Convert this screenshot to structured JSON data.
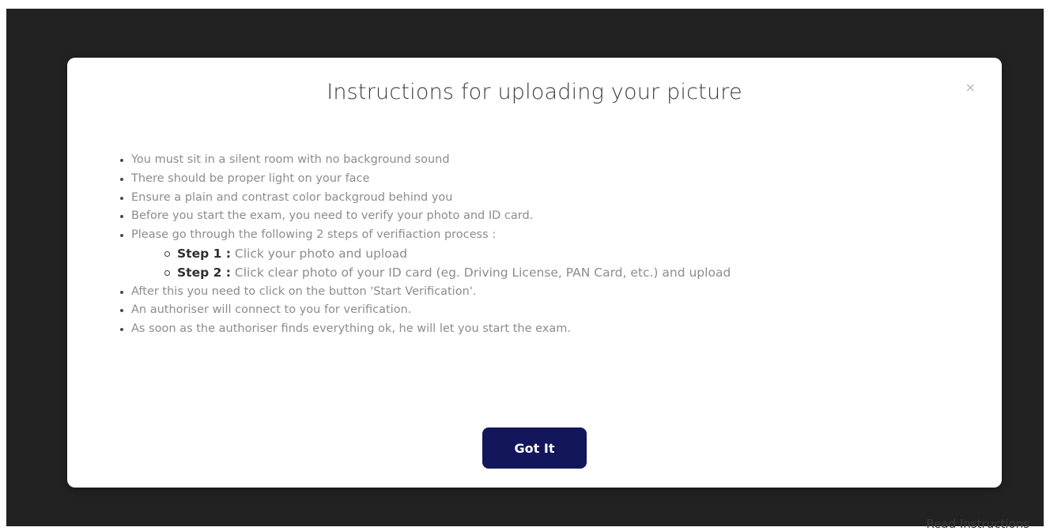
{
  "modal": {
    "title": "Instructions for uploading your picture",
    "close_label": "×",
    "instructions": [
      "You must sit in a silent room with no background sound",
      "There should be proper light on your face",
      "Ensure a plain and contrast color backgroud behind you",
      "Before you start the exam, you need to verify your photo and ID card.",
      "Please go through the following 2 steps of verifiaction process :"
    ],
    "steps": [
      {
        "label": "Step 1 :",
        "text": " Click your photo and upload"
      },
      {
        "label": "Step 2 :",
        "text": " Click clear photo of your ID card (eg. Driving License, PAN Card, etc.) and upload"
      }
    ],
    "after_steps": [
      "After this you need to click on the button 'Start Verification'.",
      "An authoriser will connect to you for verification.",
      "As soon as the authoriser finds everything ok, he will let you start the exam."
    ],
    "button_label": "Got It",
    "button_color": "#14165c"
  },
  "background": {
    "read_instructions_label": "Read Instructions"
  }
}
